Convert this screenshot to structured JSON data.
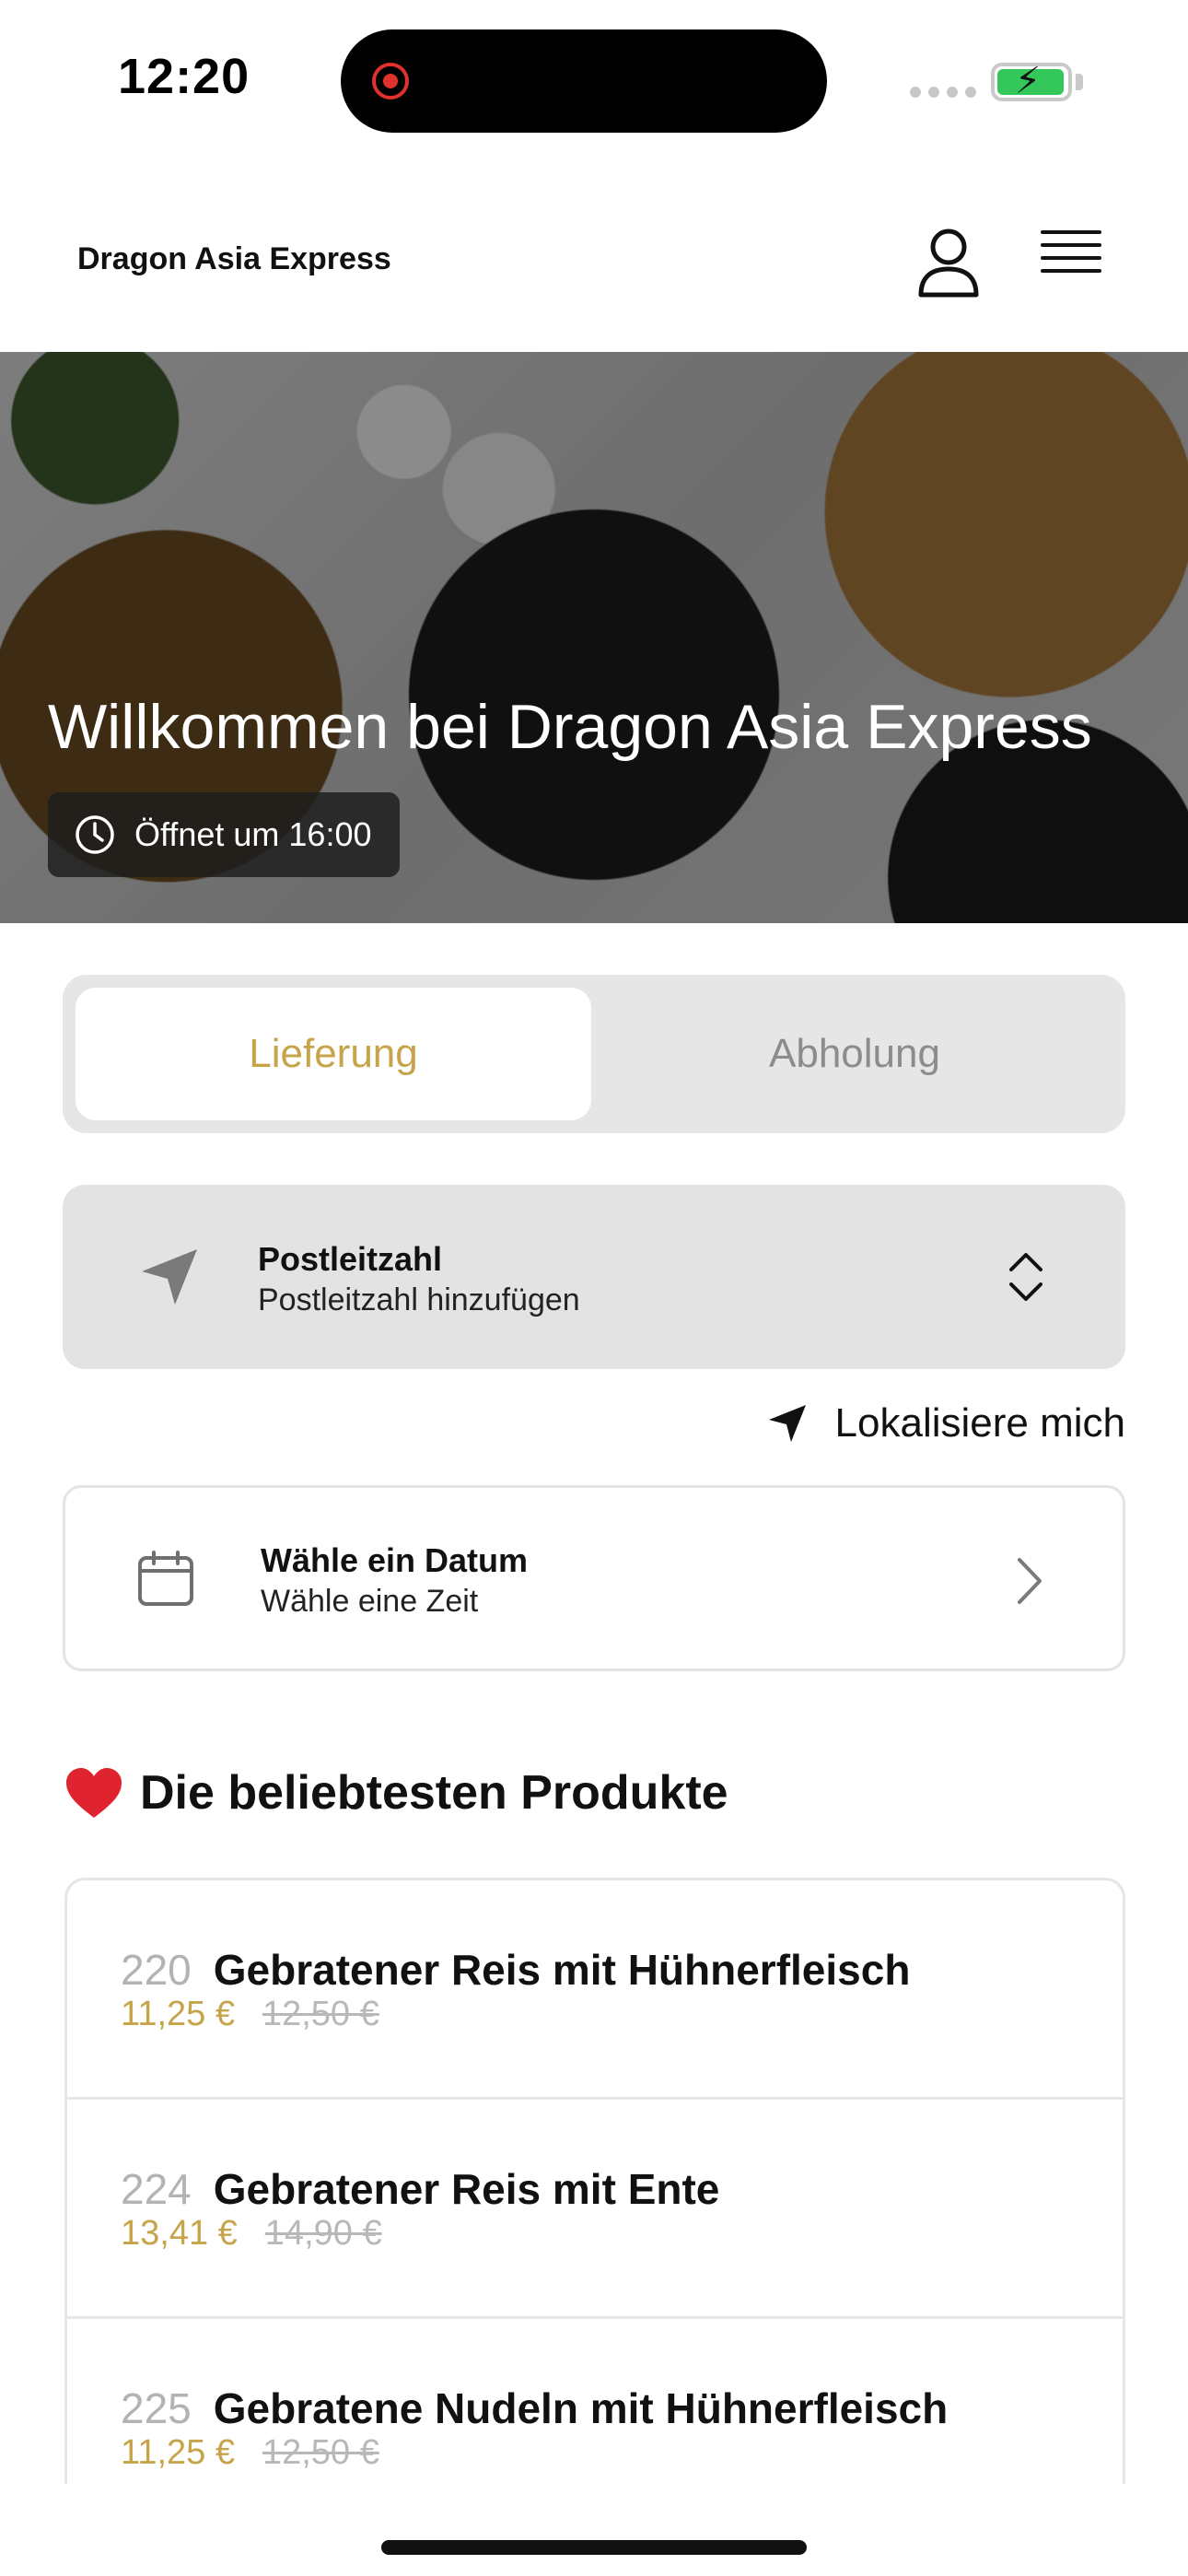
{
  "status_bar": {
    "time": "12:20",
    "battery_color": "#34c759"
  },
  "header": {
    "brand": "Dragon Asia Express",
    "profile_icon": "user-icon",
    "menu_icon": "hamburger-menu-icon"
  },
  "hero": {
    "title": "Willkommen bei Dragon Asia Express",
    "opening_text": "Öffnet um 16:00",
    "opening_icon": "clock-icon"
  },
  "order_mode": {
    "options": [
      "Lieferung",
      "Abholung"
    ],
    "selected": "Lieferung",
    "accent_color": "#c6a44a"
  },
  "postal_code": {
    "title": "Postleitzahl",
    "subtitle": "Postleitzahl hinzufügen",
    "icon": "location-arrow-icon"
  },
  "locate": {
    "label": "Lokalisiere mich",
    "icon": "location-arrow-icon"
  },
  "date_picker": {
    "title": "Wähle ein Datum",
    "subtitle": "Wähle eine Zeit",
    "icon": "calendar-icon"
  },
  "popular": {
    "emoji": "❤️",
    "title": "Die beliebtesten Produkte",
    "products": [
      {
        "number": "220",
        "name": "Gebratener Reis mit Hühnerfleisch",
        "price": "11,25 €",
        "old_price": "12,50 €"
      },
      {
        "number": "224",
        "name": "Gebratener Reis mit Ente",
        "price": "13,41 €",
        "old_price": "14,90 €"
      },
      {
        "number": "225",
        "name": "Gebratene Nudeln mit Hühnerfleisch",
        "price": "11,25 €",
        "old_price": "12,50 €"
      }
    ]
  }
}
